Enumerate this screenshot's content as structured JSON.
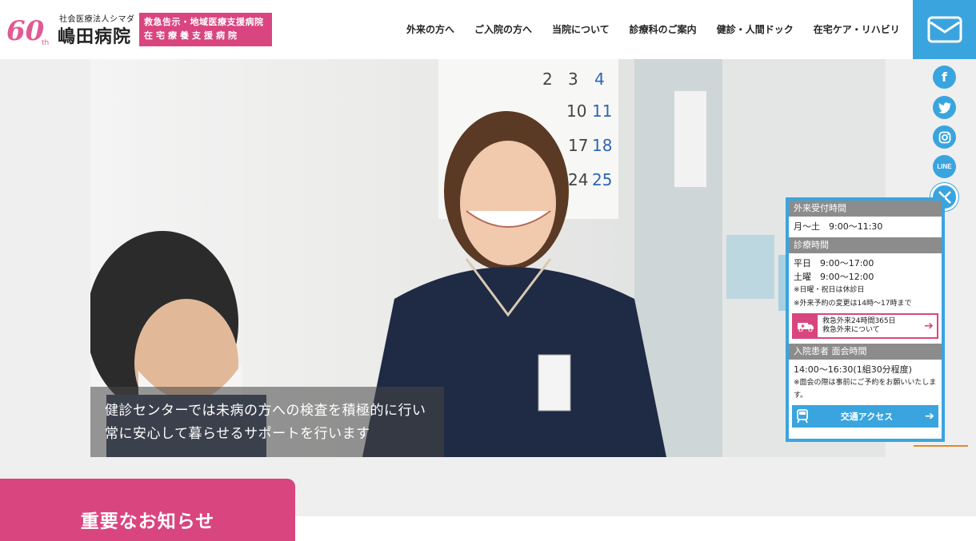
{
  "header": {
    "logo_number": "60",
    "logo_suffix": "th",
    "corp_name": "社会医療法人シマダ",
    "hospital_name": "嶋田病院",
    "badge_line1": "救急告示・地域医療支援病院",
    "badge_line2": "在宅療養支援病院"
  },
  "nav": [
    {
      "label": "外来の方へ"
    },
    {
      "label": "ご入院の方へ"
    },
    {
      "label": "当院について"
    },
    {
      "label": "診療科のご案内"
    },
    {
      "label": "健診・人間ドック"
    },
    {
      "label": "在宅ケア・リハビリ"
    }
  ],
  "hero": {
    "caption_line1": "健診センターでは未病の方への検査を積極的に行い",
    "caption_line2": "常に安心して暮らせるサポートを行います",
    "calendar_numbers": [
      "2",
      "3",
      "4",
      "10",
      "11",
      "17",
      "18",
      "24",
      "25"
    ]
  },
  "social": {
    "line_label": "LINE"
  },
  "info_panel": {
    "outpatient_heading": "外来受付時間",
    "outpatient_hours": "月〜土　9:00〜11:30",
    "consult_heading": "診療時間",
    "weekday_hours": "平日　9:00〜17:00",
    "saturday_hours": "土曜　9:00〜12:00",
    "note_closed": "※日曜・祝日は休診日",
    "note_change": "※外来予約の変更は14時〜17時まで",
    "er_line1": "救急外来24時間365日",
    "er_line2": "救急外来について",
    "visit_heading": "入院患者 面会時間",
    "visit_hours": "14:00〜16:30(1組30分程度)",
    "visit_note": "※面会の際は事前にご予約をお願いいたします。",
    "access_label": "交通アクセス"
  },
  "notice": {
    "label": "重要なお知らせ"
  },
  "colors": {
    "accent_blue": "#3aa4df",
    "accent_pink": "#d9457f",
    "header_gray": "#8c8c8c"
  }
}
